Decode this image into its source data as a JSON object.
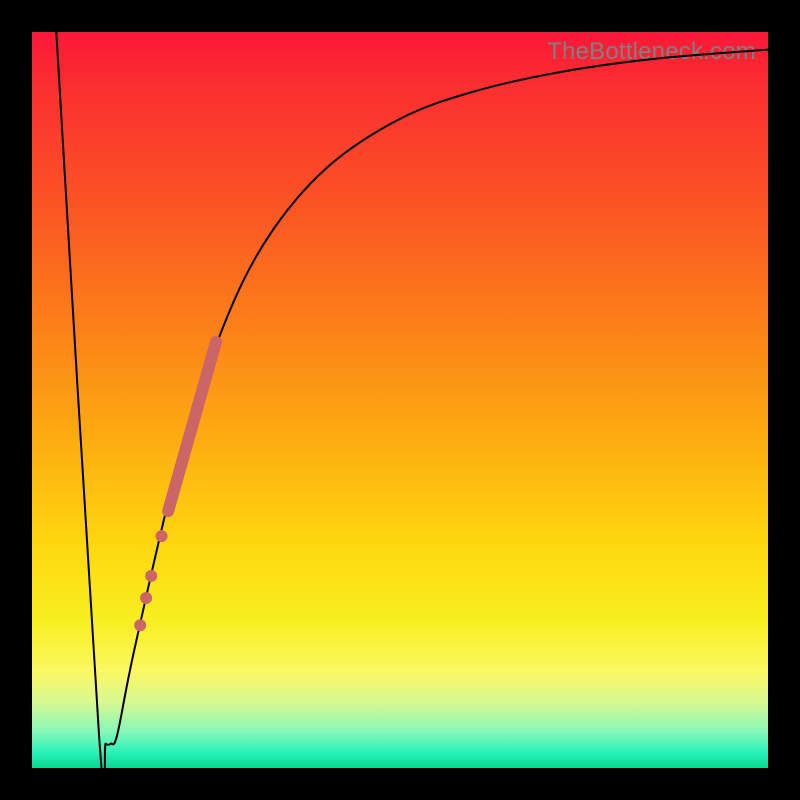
{
  "watermark": "TheBottleneck.com",
  "chart_data": {
    "type": "line",
    "title": "",
    "xlabel": "",
    "ylabel": "",
    "xlim": [
      0,
      100
    ],
    "ylim": [
      0,
      100
    ],
    "grid": false,
    "series": [
      {
        "name": "bottleneck-curve",
        "color": "#000000",
        "stroke_width": 2,
        "x": [
          3.3,
          9.1,
          10.0,
          10.7,
          11.6,
          14.0,
          20.0,
          26.0,
          32.0,
          40.0,
          50.0,
          60.0,
          72.0,
          85.0,
          100.0
        ],
        "values": [
          100.0,
          4.6,
          3.3,
          3.3,
          4.6,
          16.5,
          42.0,
          60.0,
          72.0,
          81.5,
          88.2,
          91.9,
          94.6,
          96.4,
          97.6
        ]
      }
    ],
    "markers": [
      {
        "name": "dense-segment",
        "type": "line",
        "color": "#cc6666",
        "stroke_width": 12,
        "x1": 18.5,
        "y1": 34.9,
        "x2": 25.0,
        "y2": 57.9
      },
      {
        "name": "dot-1",
        "type": "circle",
        "color": "#cc6666",
        "r": 6,
        "x": 17.6,
        "y": 31.5
      },
      {
        "name": "dot-2",
        "type": "circle",
        "color": "#cc6666",
        "r": 6,
        "x": 16.2,
        "y": 26.1
      },
      {
        "name": "dot-3",
        "type": "circle",
        "color": "#cc6666",
        "r": 6,
        "x": 15.5,
        "y": 23.1
      },
      {
        "name": "dot-4",
        "type": "circle",
        "color": "#cc6666",
        "r": 6,
        "x": 14.7,
        "y": 19.4
      }
    ]
  }
}
